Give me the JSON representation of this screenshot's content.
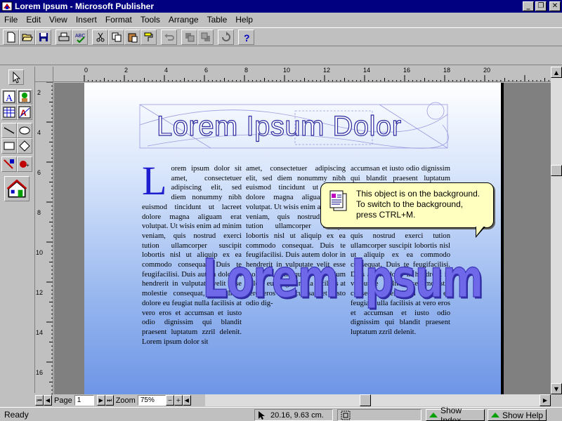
{
  "window": {
    "title": "Lorem Ipsum - Microsoft Publisher"
  },
  "menu": [
    "File",
    "Edit",
    "View",
    "Insert",
    "Format",
    "Tools",
    "Arrange",
    "Table",
    "Help"
  ],
  "toolbar": {
    "buttons": [
      "new-icon",
      "open-icon",
      "save-icon",
      "print-icon",
      "spelling-icon",
      "cut-icon",
      "copy-icon",
      "paste-icon",
      "format-painter-icon",
      "undo-icon",
      "bring-to-front-icon",
      "send-to-back-icon",
      "rotate-icon",
      "help-icon"
    ]
  },
  "rulers": {
    "horizontal": [
      "0",
      "2",
      "4",
      "6",
      "8",
      "10",
      "12",
      "14",
      "16",
      "18",
      "20"
    ],
    "vertical": [
      "2",
      "4",
      "6",
      "8",
      "10",
      "12",
      "14",
      "16"
    ]
  },
  "document": {
    "headline": "Lorem Ipsum Dolor",
    "wordart": "Lorem Ipsum",
    "dropcap": "L",
    "column1": "orem ipsum dolor sit amet, consectetuer adipiscing elit, sed diem nonummy nibh euismod tincidunt ut lacreet dolore magna aliguam erat volutpat. Ut wisis enim ad minim veniam, quis nostrud exerci tution ullamcorper suscipit lobortis nisl ut aliquip ex ea commodo consequat. Duis te feugifacilisi. Duis autem dolor in hendrerit in vulputate velit esse molestie consequat, vel illum dolore eu feugiat nulla facilisis at vero eros et accumsan et iusto odio dignissim qui blandit praesent luptatum zzril delenit. Lorem ipsum dolor sit",
    "column2": "amet, consectetuer adipiscing elit, sed diem nonummy nibh euismod tincidunt ut lacreet dolore magna aliguam erat volutpat. Ut wisis enim ad minim veniam, quis nostrud exerci tution ullamcorper suscipit lobortis nisl ut aliquip ex ea commodo consequat. Duis te feugifacilisi. Duis autem dolor in hendrerit in vulputate velit esse molestie consequat, vel illum dolore eu feugiat nulla facilisis at vero eros et accumsan et iusto odio dig-",
    "column3": "accumsan et iusto odio dignissim qui blandit praesent luptatum zzril delenit augue duis dolore te feugait nulla facilisi. Lorem ipsum dolor sit amet, con lore magna aliguam erat volutpat. Ut wisis enim ad minim veniam, quis nostrud exerci tution ullamcorper suscipit lobortis nisl ut aliquip ex ea commodo consequat. Duis te feugifacilisi. Duis autem dolor in hendrerit in vulputate velit esse molestie consequat, vel illum dolore eu feugiat nulla facilisis at vero eros et accumsan et iusto odio dignissim qui blandit praesent luptatum zzril delenit."
  },
  "tooltip": {
    "lines": [
      "This object is on the background.",
      "To switch to the background,",
      "press CTRL+M."
    ]
  },
  "bottom": {
    "page_label": "Page",
    "page_value": "1",
    "zoom_label": "Zoom",
    "zoom_value": "75%"
  },
  "status": {
    "ready": "Ready",
    "position": "20.16, 9.63 cm.",
    "show_index": "Show Index",
    "show_help": "Show Help"
  },
  "colors": {
    "title_bar": "#000080",
    "headline_outline": "#2a2aa0",
    "dropcap": "#1f1fd0",
    "wordart_fill": "#6f68e8",
    "tooltip_bg": "#ffffc0"
  }
}
